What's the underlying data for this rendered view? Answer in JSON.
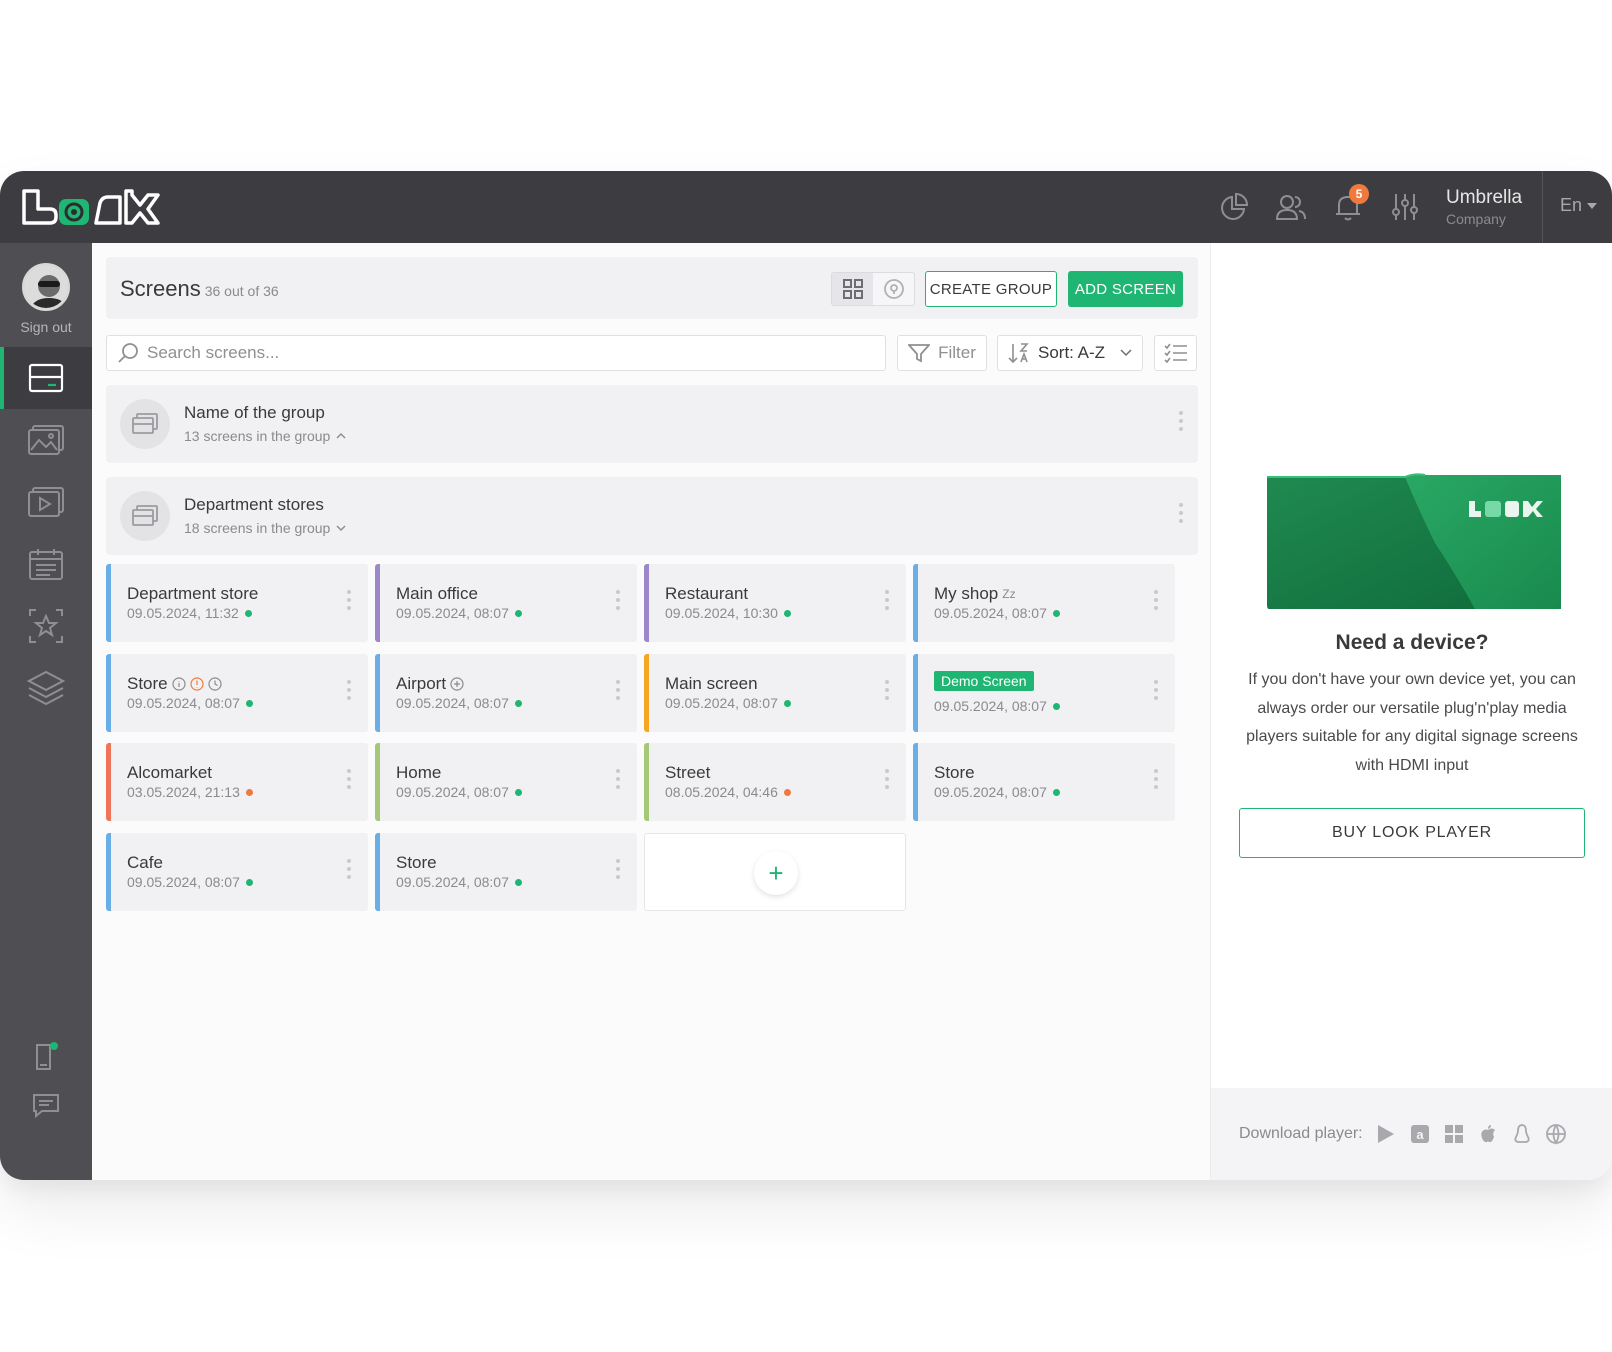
{
  "topbar": {
    "notifications_count": "5",
    "company_name": "Umbrella",
    "company_sub": "Company",
    "language": "En"
  },
  "sidebar": {
    "signout_label": "Sign out",
    "items": [
      "screens",
      "media",
      "playlists",
      "schedule",
      "favorites",
      "layers"
    ]
  },
  "header": {
    "title": "Screens",
    "count": "36 out of 36",
    "create_group_label": "CREATE GROUP",
    "add_screen_label": "ADD SCREEN"
  },
  "search": {
    "placeholder": "Search screens..."
  },
  "toolbar": {
    "filter_label": "Filter",
    "sort_label": "Sort: A-Z"
  },
  "groups": [
    {
      "name": "Name of the group",
      "sub": "13 screens in the group",
      "chevron": "^"
    },
    {
      "name": "Department stores",
      "sub": "18 screens in the group",
      "chevron": "v"
    }
  ],
  "screens": [
    {
      "name": "Department store",
      "date": "09.05.2024, 11:32",
      "bar": "#6aaee8",
      "status": "#1fb573"
    },
    {
      "name": "Main office",
      "date": "09.05.2024, 08:07",
      "bar": "#9b87c9",
      "status": "#1fb573"
    },
    {
      "name": "Restaurant",
      "date": "09.05.2024, 10:30",
      "bar": "#9b87c9",
      "status": "#1fb573"
    },
    {
      "name": "My shop",
      "suffix": "Zz",
      "date": "09.05.2024, 08:07",
      "bar": "#6aaee8",
      "status": "#1fb573"
    },
    {
      "name": "Store",
      "date": "09.05.2024, 08:07",
      "bar": "#6aaee8",
      "status": "#1fb573"
    },
    {
      "name": "Airport",
      "date": "09.05.2024, 08:07",
      "bar": "#6aaee8",
      "status": "#1fb573"
    },
    {
      "name": "Main screen",
      "date": "09.05.2024, 08:07",
      "bar": "#f5a623",
      "status": "#1fb573"
    },
    {
      "badge": "Demo Screen",
      "date": "09.05.2024, 08:07",
      "bar": "#6aaee8",
      "status": "#1fb573"
    },
    {
      "name": "Alcomarket",
      "date": "03.05.2024, 21:13",
      "bar": "#f0745a",
      "status": "#f07a3e"
    },
    {
      "name": "Home",
      "date": "09.05.2024, 08:07",
      "bar": "#a5c878",
      "status": "#1fb573"
    },
    {
      "name": "Street",
      "date": "08.05.2024, 04:46",
      "bar": "#a5c878",
      "status": "#f07a3e"
    },
    {
      "name": "Store",
      "date": "09.05.2024, 08:07",
      "bar": "#6aaee8",
      "status": "#1fb573"
    },
    {
      "name": "Cafe",
      "date": "09.05.2024, 08:07",
      "bar": "#6aaee8",
      "status": "#1fb573"
    },
    {
      "name": "Store",
      "date": "09.05.2024, 08:07",
      "bar": "#6aaee8",
      "status": "#1fb573"
    }
  ],
  "right_panel": {
    "title": "Need a device?",
    "text": "If you don't have your own device yet, you can always order our versatile plug'n'play media players suitable for any digital signage screens with HDMI input",
    "buy_label": "BUY LOOK PLAYER",
    "download_label": "Download player:",
    "platforms": [
      "google-play-icon",
      "amazon-icon",
      "windows-icon",
      "apple-icon",
      "linux-icon",
      "web-icon"
    ]
  },
  "colors": {
    "accent": "#1fb573",
    "topbar": "#3d3d41",
    "sidebar": "#4f4f53",
    "warning": "#f07a3e"
  }
}
